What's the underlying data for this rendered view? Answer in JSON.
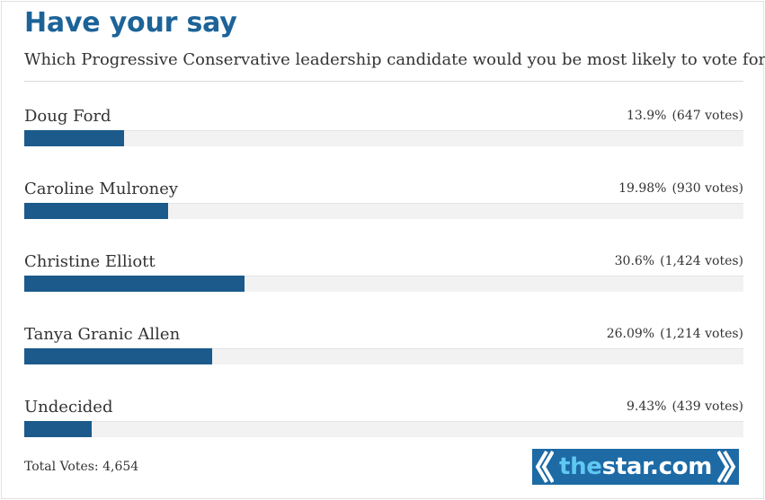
{
  "poll": {
    "title": "Have your say",
    "question": "Which Progressive Conservative leadership candidate would you be most likely to vote for?",
    "options": [
      {
        "name": "Doug Ford",
        "percent": "13.9%",
        "votes": "(647 votes)",
        "fraction": 0.139
      },
      {
        "name": "Caroline Mulroney",
        "percent": "19.98%",
        "votes": "(930 votes)",
        "fraction": 0.1998
      },
      {
        "name": "Christine Elliott",
        "percent": "30.6%",
        "votes": "(1,424 votes)",
        "fraction": 0.306
      },
      {
        "name": "Tanya Granic Allen",
        "percent": "26.09%",
        "votes": "(1,214 votes)",
        "fraction": 0.2609
      },
      {
        "name": "Undecided",
        "percent": "9.43%",
        "votes": "(439 votes)",
        "fraction": 0.0943
      }
    ],
    "total_votes": "Total Votes: 4,654"
  },
  "logo": {
    "part1": "the",
    "part2": "star.com",
    "name": "thestar-logo"
  },
  "colors": {
    "title": "#1c6398",
    "bar_fill": "#1b5a8b",
    "logo_bg": "#1d6aa5",
    "logo_accent": "#61c8f1"
  }
}
